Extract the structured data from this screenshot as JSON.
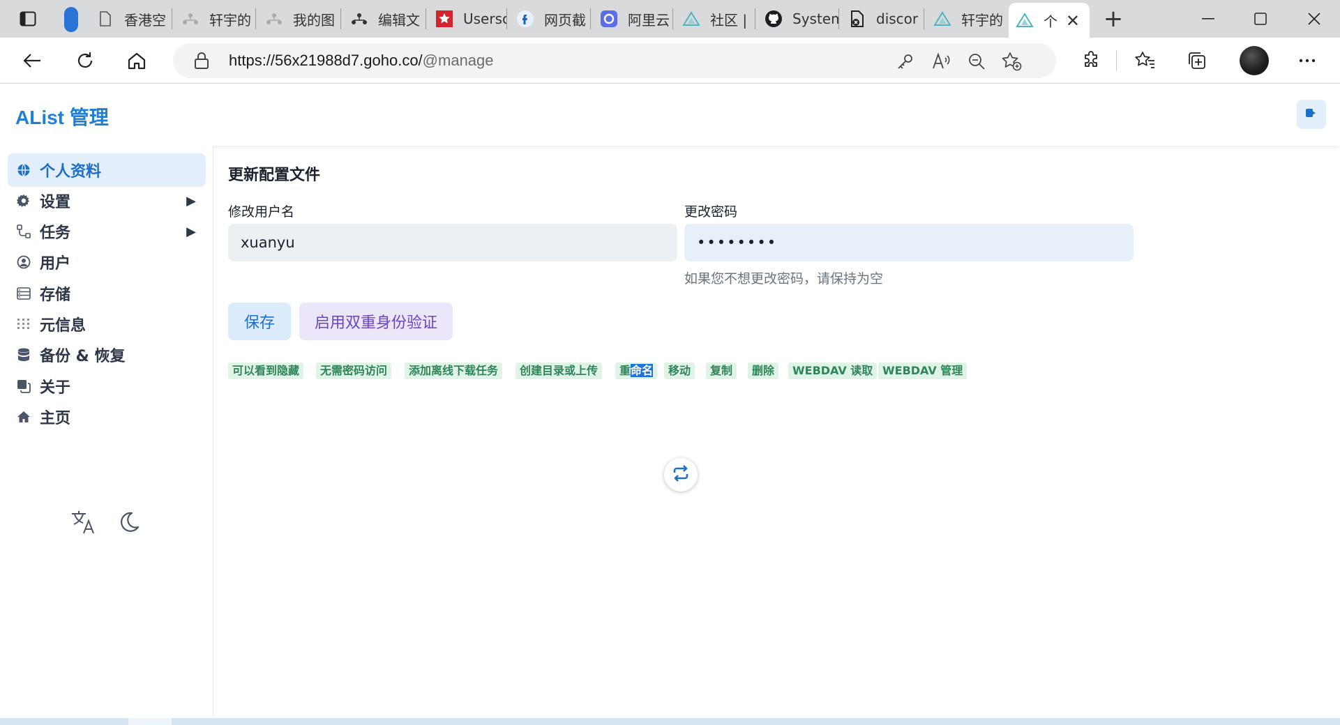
{
  "browser": {
    "tabs": [
      {
        "title": "香港空",
        "icon": "page-icon"
      },
      {
        "title": "轩宇的",
        "icon": "network-icon"
      },
      {
        "title": "我的图",
        "icon": "network-icon"
      },
      {
        "title": "编辑文",
        "icon": "network-icon"
      },
      {
        "title": "Userscr",
        "icon": "star-badge-icon"
      },
      {
        "title": "网页截",
        "icon": "f-logo-icon"
      },
      {
        "title": "阿里云",
        "icon": "c-logo-icon"
      },
      {
        "title": "社区 |",
        "icon": "alist-icon"
      },
      {
        "title": "System",
        "icon": "github-icon"
      },
      {
        "title": "discor",
        "icon": "file-x-icon"
      },
      {
        "title": "轩宇的",
        "icon": "alist-icon"
      },
      {
        "title": "个",
        "icon": "alist-icon"
      }
    ],
    "url_main": "https://56x21988d7.goho.co/",
    "url_dim": "@manage",
    "colors": {
      "tab_strip": "#d9dadc",
      "accent": "#2a73d6"
    }
  },
  "app": {
    "title": "AList 管理",
    "brand_color": "#1e7fd6"
  },
  "sidebar": {
    "items": [
      {
        "label": "个人资料",
        "icon": "globe-icon",
        "active": true
      },
      {
        "label": "设置",
        "icon": "gear-icon",
        "expandable": true
      },
      {
        "label": "任务",
        "icon": "flow-icon",
        "expandable": true
      },
      {
        "label": "用户",
        "icon": "user-circle-icon"
      },
      {
        "label": "存储",
        "icon": "storage-icon"
      },
      {
        "label": "元信息",
        "icon": "meta-icon"
      },
      {
        "label": "备份 & 恢复",
        "icon": "database-icon"
      },
      {
        "label": "关于",
        "icon": "copy-icon"
      },
      {
        "label": "主页",
        "icon": "home-icon"
      }
    ]
  },
  "profile": {
    "section_title": "更新配置文件",
    "username_label": "修改用户名",
    "username_value": "xuanyu",
    "password_label": "更改密码",
    "password_value": "••••••••",
    "password_hint": "如果您不想更改密码，请保持为空",
    "save_label": "保存",
    "twofa_label": "启用双重身份验证",
    "permissions": [
      "可以看到隐藏",
      "无需密码访问",
      "添加离线下载任务",
      "创建目录或上传",
      "重命名",
      "移动",
      "复制",
      "删除",
      "WEBDAV 读取",
      "WEBDAV 管理"
    ],
    "rename_prefix": "重",
    "rename_selected": "命名"
  }
}
